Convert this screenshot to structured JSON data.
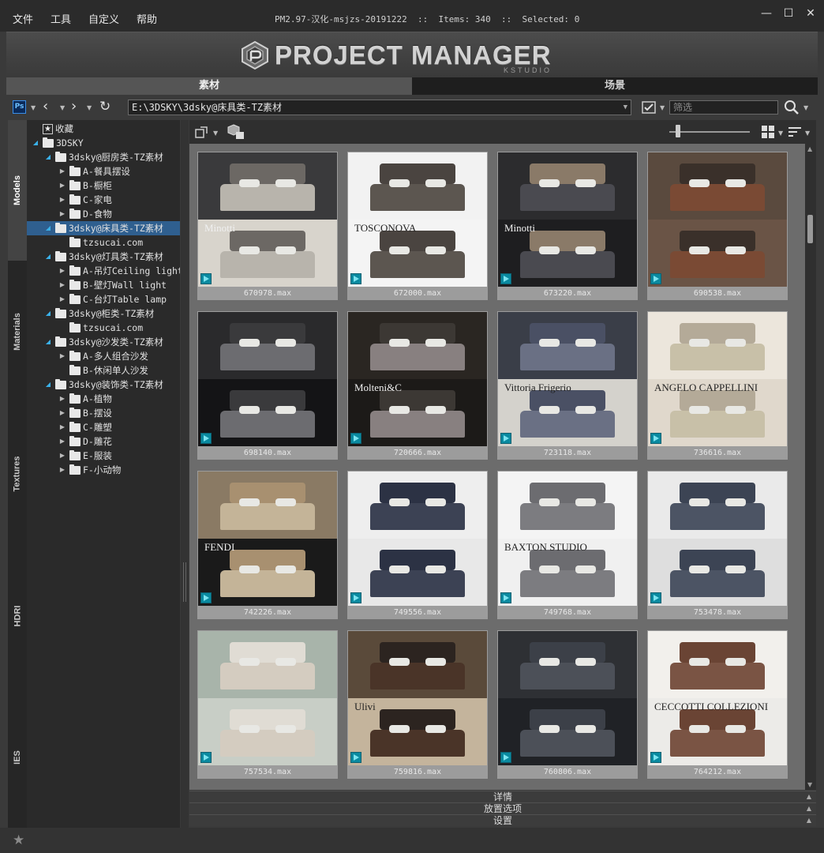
{
  "menu": [
    "文件",
    "工具",
    "自定义",
    "帮助"
  ],
  "title": {
    "version": "PM2.97-汉化-msjzs-20191222",
    "items_label": "Items:",
    "items_count": "340",
    "selected_label": "Selected:",
    "selected_count": "0"
  },
  "window_controls": [
    "—",
    "☐",
    "✕"
  ],
  "banner": {
    "title": "PROJECT MANAGER",
    "subtitle": "KSTUDIO"
  },
  "main_tabs": [
    {
      "label": "素材",
      "active": true
    },
    {
      "label": "场景",
      "active": false
    }
  ],
  "toolbar": {
    "ps_label": "Ps",
    "path": "E:\\3DSKY\\3dsky@床具类-TZ素材",
    "filter_placeholder": "筛选"
  },
  "side_tabs": [
    "Models",
    "Materials",
    "Textures",
    "HDRI",
    "IES"
  ],
  "tree": [
    {
      "label": "收藏",
      "depth": 0,
      "arrow": "",
      "icon": "star"
    },
    {
      "label": "3DSKY",
      "depth": 0,
      "arrow": "open",
      "icon": "folder"
    },
    {
      "label": "3dsky@厨房类-TZ素材",
      "depth": 1,
      "arrow": "open",
      "icon": "folder"
    },
    {
      "label": "A-餐具摆设",
      "depth": 2,
      "arrow": "closed",
      "icon": "folder"
    },
    {
      "label": "B-橱柜",
      "depth": 2,
      "arrow": "closed",
      "icon": "folder"
    },
    {
      "label": "C-家电",
      "depth": 2,
      "arrow": "closed",
      "icon": "folder"
    },
    {
      "label": "D-食物",
      "depth": 2,
      "arrow": "closed",
      "icon": "folder"
    },
    {
      "label": "3dsky@床具类-TZ素材",
      "depth": 1,
      "arrow": "open",
      "icon": "folder",
      "selected": true
    },
    {
      "label": "tzsucai.com",
      "depth": 2,
      "arrow": "",
      "icon": "folder"
    },
    {
      "label": "3dsky@灯具类-TZ素材",
      "depth": 1,
      "arrow": "open",
      "icon": "folder"
    },
    {
      "label": "A-吊灯Ceiling light",
      "depth": 2,
      "arrow": "closed",
      "icon": "folder"
    },
    {
      "label": "B-壁灯Wall light",
      "depth": 2,
      "arrow": "closed",
      "icon": "folder"
    },
    {
      "label": "C-台灯Table lamp",
      "depth": 2,
      "arrow": "closed",
      "icon": "folder"
    },
    {
      "label": "3dsky@柜类-TZ素材",
      "depth": 1,
      "arrow": "open",
      "icon": "folder"
    },
    {
      "label": "tzsucai.com",
      "depth": 2,
      "arrow": "",
      "icon": "folder"
    },
    {
      "label": "3dsky@沙发类-TZ素材",
      "depth": 1,
      "arrow": "open",
      "icon": "folder"
    },
    {
      "label": "A-多人组合沙发",
      "depth": 2,
      "arrow": "closed",
      "icon": "folder"
    },
    {
      "label": "B-休闲单人沙发",
      "depth": 2,
      "arrow": "",
      "icon": "folder"
    },
    {
      "label": "3dsky@装饰类-TZ素材",
      "depth": 1,
      "arrow": "open",
      "icon": "folder"
    },
    {
      "label": "A-植物",
      "depth": 2,
      "arrow": "closed",
      "icon": "folder"
    },
    {
      "label": "B-摆设",
      "depth": 2,
      "arrow": "closed",
      "icon": "folder"
    },
    {
      "label": "C-雕塑",
      "depth": 2,
      "arrow": "closed",
      "icon": "folder"
    },
    {
      "label": "D-雕花",
      "depth": 2,
      "arrow": "closed",
      "icon": "folder"
    },
    {
      "label": "E-服装",
      "depth": 2,
      "arrow": "closed",
      "icon": "folder"
    },
    {
      "label": "F-小动物",
      "depth": 2,
      "arrow": "closed",
      "icon": "folder"
    }
  ],
  "thumbnails": [
    {
      "file": "670978.max",
      "brand": "Minotti",
      "top": "#3a3a3c",
      "bottom": "#d8d4cc",
      "bed": "#b8b4ac",
      "head": "#6c6864"
    },
    {
      "file": "672000.max",
      "brand": "TOSCONOVA",
      "top": "#f2f2f2",
      "bottom": "#f4f4f4",
      "bed": "#5c5650",
      "head": "#4a4440"
    },
    {
      "file": "673220.max",
      "brand": "Minotti",
      "top": "#2c2c2e",
      "bottom": "#1e1e20",
      "bed": "#4a4a50",
      "head": "#8a7a68"
    },
    {
      "file": "690538.max",
      "brand": "",
      "top": "#5a4a3e",
      "bottom": "#6a5446",
      "bed": "#7a4a34",
      "head": "#3a302a"
    },
    {
      "file": "698140.max",
      "brand": "",
      "top": "#2a2a2c",
      "bottom": "#141416",
      "bed": "#6c6c70",
      "head": "#3a3a3c"
    },
    {
      "file": "720666.max",
      "brand": "Molteni&C",
      "top": "#2a2622",
      "bottom": "#1c1a18",
      "bed": "#888080",
      "head": "#3c3834"
    },
    {
      "file": "723118.max",
      "brand": "Vittoria Frigerio",
      "top": "#3a3e48",
      "bottom": "#d4d2cc",
      "bed": "#6a7084",
      "head": "#4a5064"
    },
    {
      "file": "736616.max",
      "brand": "ANGELO CAPPELLINI",
      "top": "#ece6dc",
      "bottom": "#e0d8cc",
      "bed": "#c8c0a8",
      "head": "#b4aa98"
    },
    {
      "file": "742226.max",
      "brand": "FENDI",
      "top": "#8a7a64",
      "bottom": "#1a1a1a",
      "bed": "#c4b498",
      "head": "#a89070"
    },
    {
      "file": "749556.max",
      "brand": "",
      "top": "#eeeeee",
      "bottom": "#e8e8e8",
      "bed": "#3c4254",
      "head": "#2c3244"
    },
    {
      "file": "749768.max",
      "brand": "BAXTON STUDIO",
      "top": "#f4f4f4",
      "bottom": "#f0f0f0",
      "bed": "#7c7c80",
      "head": "#6c6c70"
    },
    {
      "file": "753478.max",
      "brand": "",
      "top": "#eaeaea",
      "bottom": "#dedede",
      "bed": "#4c5464",
      "head": "#3c4454"
    },
    {
      "file": "757534.max",
      "brand": "",
      "top": "#a8b4aa",
      "bottom": "#c8cec6",
      "bed": "#d4ccc0",
      "head": "#e0dcd4"
    },
    {
      "file": "759816.max",
      "brand": "Ulivi",
      "top": "#5a4a3a",
      "bottom": "#c4b49c",
      "bed": "#4a3428",
      "head": "#2c2420"
    },
    {
      "file": "760806.max",
      "brand": "",
      "top": "#2e3034",
      "bottom": "#202226",
      "bed": "#4c5058",
      "head": "#3c4048"
    },
    {
      "file": "764212.max",
      "brand": "CECCOTTI COLLEZIONI",
      "top": "#f2f0ec",
      "bottom": "#ecebe8",
      "bed": "#7a5444",
      "head": "#6a4434"
    }
  ],
  "accordions": [
    "详情",
    "放置选项",
    "设置"
  ]
}
